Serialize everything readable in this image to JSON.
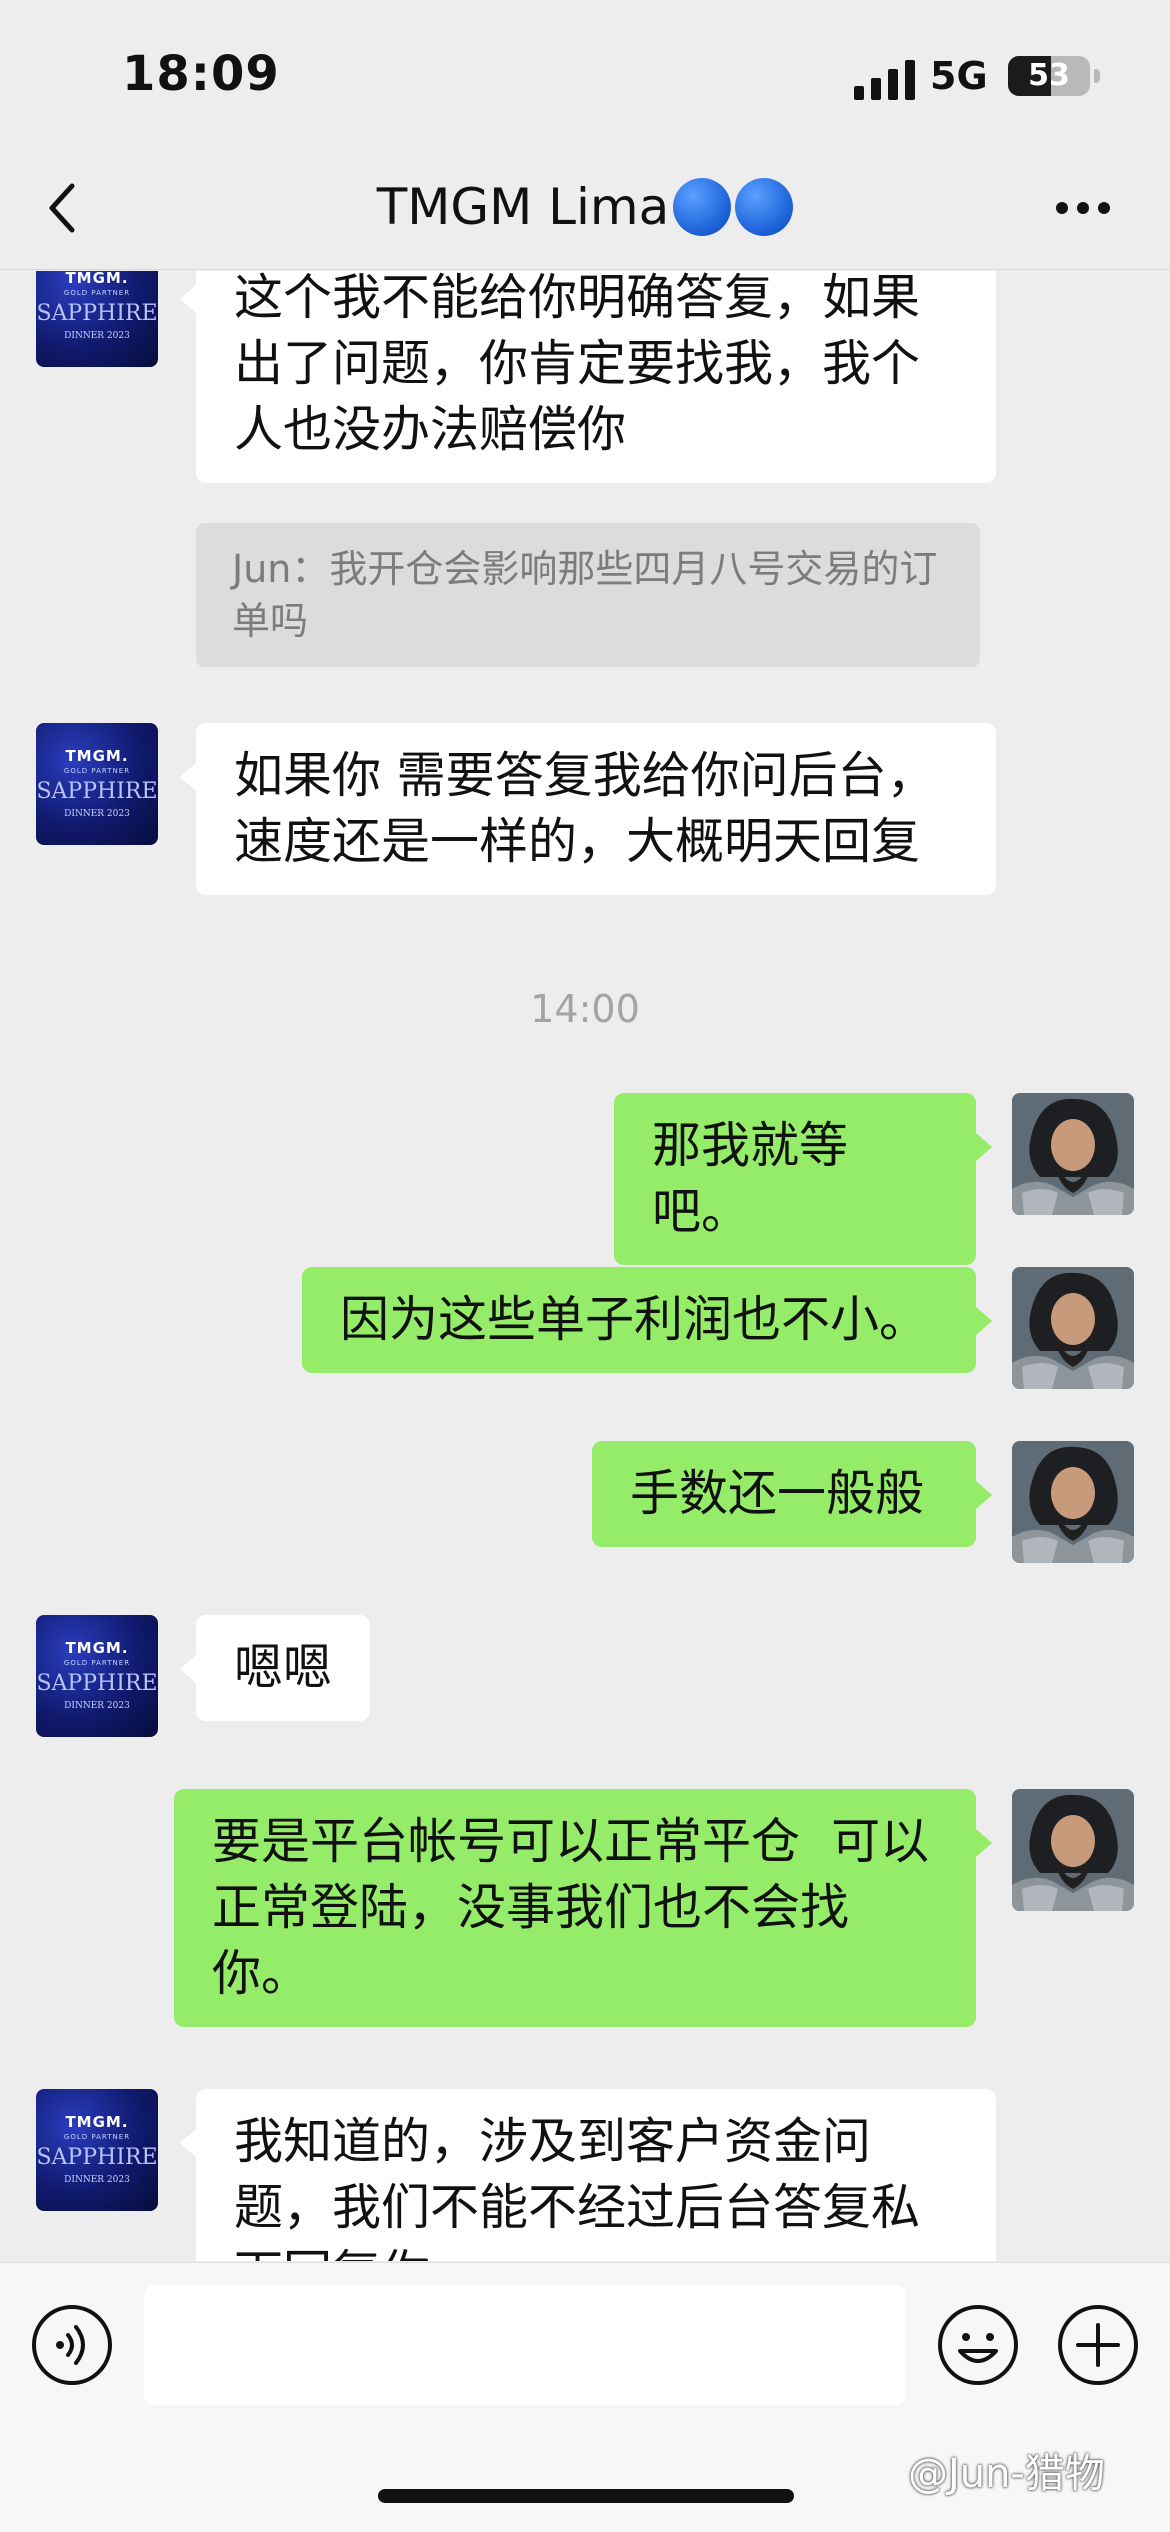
{
  "status_bar": {
    "time": "18:09",
    "network": "5G",
    "battery": "53",
    "battery_level": 0.53
  },
  "nav": {
    "title": "TMGM Lima",
    "title_emoji": "🔵🔵"
  },
  "contact_avatar": {
    "brand": "TMGM.",
    "sub": "GOLD PARTNER",
    "main": "SAPPHIRE",
    "foot": "DINNER 2023"
  },
  "messages": [
    {
      "side": "left",
      "text": "这个我不能给你明确答复，如果出了问题，你肯定要找我，我个人也没办法赔偿你"
    },
    {
      "side": "left",
      "quote": "Jun：我开仓会影响那些四月八号交易的订单吗"
    },
    {
      "side": "left",
      "text": "如果你 需要答复我给你问后台，速度还是一样的，大概明天回复"
    },
    {
      "timestamp": "14:00"
    },
    {
      "side": "right",
      "text": "那我就等吧。"
    },
    {
      "side": "right",
      "text": "因为这些单子利润也不小。"
    },
    {
      "side": "right",
      "text": "手数还一般般"
    },
    {
      "side": "left",
      "text": "嗯嗯"
    },
    {
      "side": "right",
      "text": "要是平台帐号可以正常平仓  可以正常登陆，没事我们也不会找你。"
    },
    {
      "side": "left",
      "text": "我知道的，涉及到客户资金问题，我们不能不经过后台答复私下回复你。"
    }
  ],
  "input": {
    "value": "",
    "watermark": "@Jun-猎物"
  },
  "icons": {
    "back": "chevron-left-icon",
    "more": "more-horizontal-icon",
    "voice": "voice-icon",
    "emoji": "emoji-icon",
    "add": "plus-icon"
  }
}
